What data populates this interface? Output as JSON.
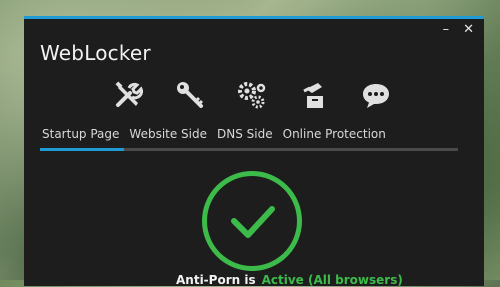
{
  "app": {
    "title": "WebLocker",
    "accent_color": "#1e9bd4",
    "success_color": "#3dbb4a"
  },
  "window_controls": {
    "minimize": "–",
    "close": "✕"
  },
  "icon_toolbar": [
    {
      "icon": "tools-icon"
    },
    {
      "icon": "key-icon"
    },
    {
      "icon": "gears-icon"
    },
    {
      "icon": "hand-ballot-icon"
    },
    {
      "icon": "chat-bubble-icon"
    }
  ],
  "tabs": [
    {
      "label": "Startup Page",
      "selected": true
    },
    {
      "label": "Website Side",
      "selected": false
    },
    {
      "label": "DNS Side",
      "selected": false
    },
    {
      "label": "Online Protection",
      "selected": false
    }
  ],
  "status": {
    "label": "Anti-Porn is",
    "value": "Active (All browsers)"
  }
}
